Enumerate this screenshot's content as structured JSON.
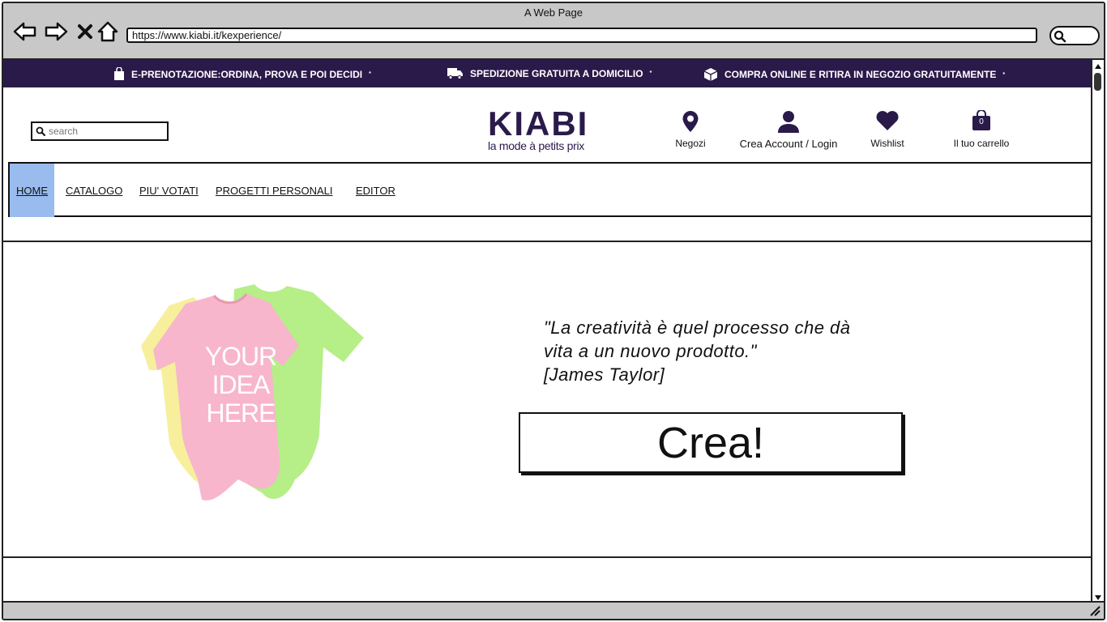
{
  "browser": {
    "window_title": "A Web Page",
    "url": "https://www.kiabi.it/kexperience/"
  },
  "promo_bar": {
    "items": [
      {
        "icon": "shopping-bag-icon",
        "text": "E-PRENOTAZIONE:ORDINA, PROVA E POI DECIDI",
        "mark": "*"
      },
      {
        "icon": "truck-icon",
        "text": "SPEDIZIONE GRATUITA A DOMICILIO",
        "mark": "*"
      },
      {
        "icon": "box-icon",
        "text": "COMPRA ONLINE E RITIRA IN NEGOZIO GRATUITAMENTE",
        "mark": "*"
      }
    ],
    "background": "#2a1a4a"
  },
  "header": {
    "search_placeholder": "search",
    "logo": {
      "word": "KIABI",
      "tagline": "la mode à petits prix"
    },
    "links": {
      "stores": "Negozi",
      "account": "Crea Account / Login",
      "wishlist": "Wishlist",
      "cart": "Il tuo carrello",
      "cart_count": "0"
    }
  },
  "menu": {
    "items": [
      {
        "label": "HOME",
        "active": true
      },
      {
        "label": "CATALOGO"
      },
      {
        "label": "PIU' VOTATI"
      },
      {
        "label": "PROGETTI PERSONALI"
      },
      {
        "label": "EDITOR"
      }
    ],
    "active_color": "#99bbee"
  },
  "hero": {
    "onesie_text": [
      "YOUR",
      "IDEA",
      "HERE"
    ],
    "quote_line1": "\"La creatività è quel processo che dà",
    "quote_line2": "vita a un nuovo prodotto.\"",
    "quote_author": "[James Taylor]",
    "cta_label": "Crea!"
  }
}
